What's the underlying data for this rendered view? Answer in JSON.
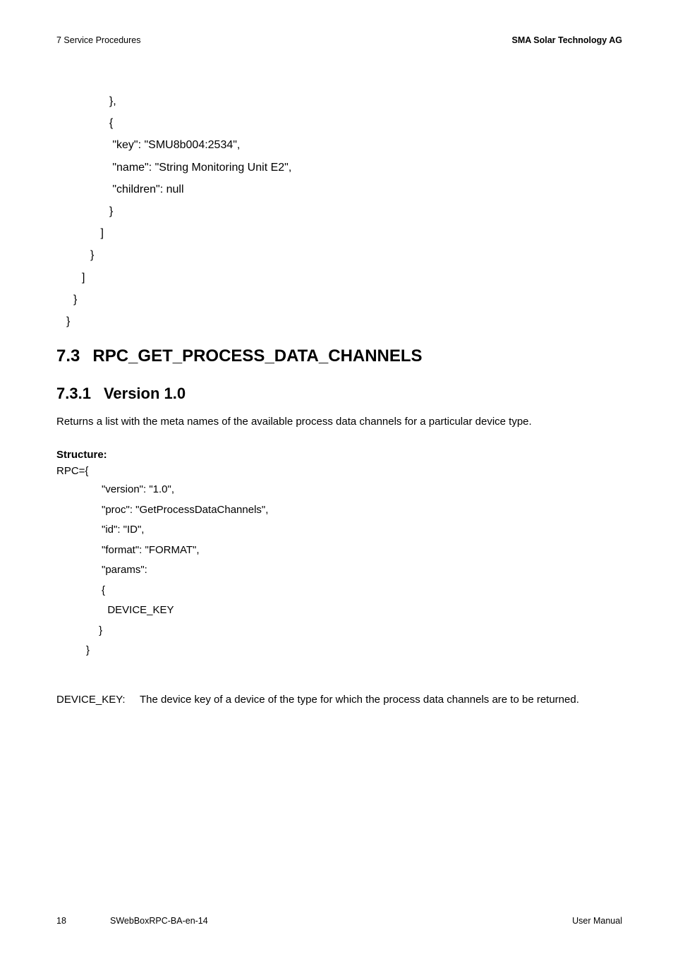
{
  "header": {
    "left": "7 Service Procedures",
    "right": "SMA Solar Technology AG"
  },
  "code_lines": [
    "  },",
    "  {",
    "   \"key\": \"SMU8b004:2534\",",
    "   \"name\": \"String Monitoring Unit E2\",",
    "   \"children\": null",
    "  }",
    " ]",
    "}",
    "]",
    "}",
    "}"
  ],
  "section_73": {
    "num": "7.3",
    "title": "RPC_GET_PROCESS_DATA_CHANNELS"
  },
  "section_731": {
    "num": "7.3.1",
    "title": "Version 1.0"
  },
  "paragraph_731": "Returns a list with the meta names of the available process data channels for a particular device type.",
  "structure_label": "Structure:",
  "rpc_open": "RPC={",
  "rpc_lines": [
    "\"version\": \"1.0\",",
    "\"proc\": \"GetProcessDataChannels\",",
    "\"id\": \"ID\",",
    "\"format\": \"FORMAT\",",
    "\"params\":",
    "{",
    "  DEVICE_KEY",
    " }",
    "}"
  ],
  "device_key": {
    "term": "DEVICE_KEY:",
    "defn": "The device key of a device of the type for which the process data channels are to be returned."
  },
  "footer": {
    "page": "18",
    "docid": "SWebBoxRPC-BA-en-14",
    "right": "User Manual"
  }
}
